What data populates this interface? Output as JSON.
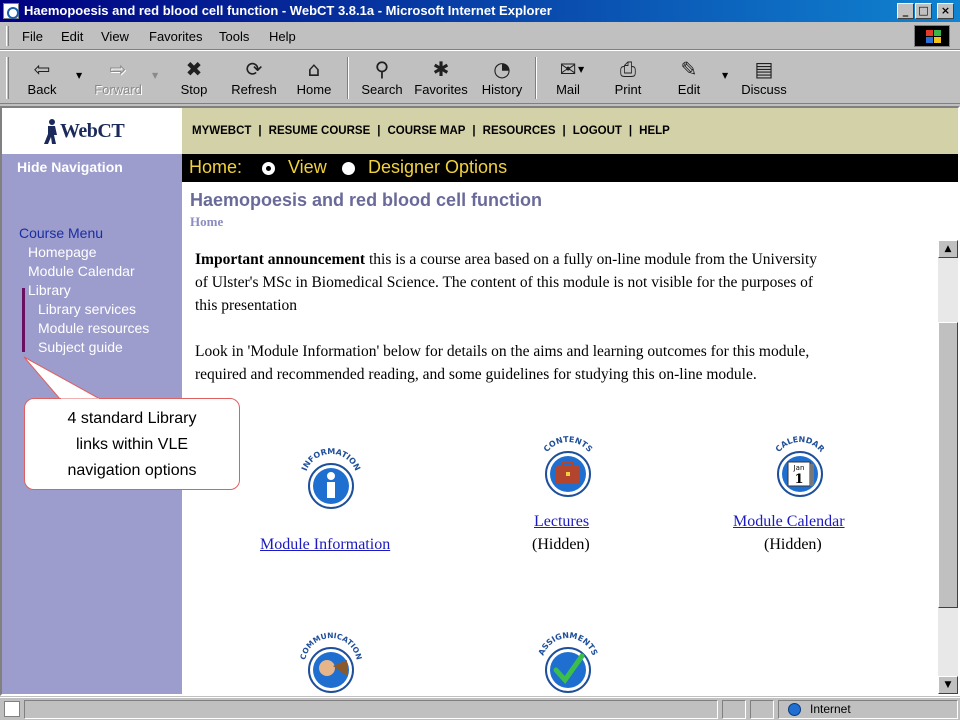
{
  "window": {
    "title": "Haemopoesis and red blood cell function - WebCT 3.8.1a - Microsoft Internet Explorer",
    "minimize": "_",
    "maximize": "□",
    "close": "×"
  },
  "menubar": {
    "items": [
      {
        "label": "File"
      },
      {
        "label": "Edit"
      },
      {
        "label": "View"
      },
      {
        "label": "Favorites"
      },
      {
        "label": "Tools"
      },
      {
        "label": "Help"
      }
    ]
  },
  "toolbar": {
    "buttons": [
      {
        "label": "Back",
        "icon": "back-arrow-icon",
        "glyph": "⇦"
      },
      {
        "label": "Forward",
        "icon": "forward-arrow-icon",
        "glyph": "⇨"
      },
      {
        "label": "Stop",
        "icon": "stop-icon",
        "glyph": "✖"
      },
      {
        "label": "Refresh",
        "icon": "refresh-icon",
        "glyph": "⟳"
      },
      {
        "label": "Home",
        "icon": "home-icon",
        "glyph": "⌂"
      },
      {
        "label": "Search",
        "icon": "search-icon",
        "glyph": "⚲"
      },
      {
        "label": "Favorites",
        "icon": "favorites-icon",
        "glyph": "✱"
      },
      {
        "label": "History",
        "icon": "history-icon",
        "glyph": "◔"
      },
      {
        "label": "Mail",
        "icon": "mail-icon",
        "glyph": "✉"
      },
      {
        "label": "Print",
        "icon": "print-icon",
        "glyph": "⎙"
      },
      {
        "label": "Edit",
        "icon": "edit-icon",
        "glyph": "✎"
      },
      {
        "label": "Discuss",
        "icon": "discuss-icon",
        "glyph": "▤"
      }
    ]
  },
  "webct": {
    "logo_text": "WebCT",
    "topnav": [
      "MYWEBCT",
      "RESUME COURSE",
      "COURSE MAP",
      "RESOURCES",
      "LOGOUT",
      "HELP"
    ],
    "topnav_sep": "|"
  },
  "leftnav": {
    "hide_label": "Hide Navigation",
    "course_menu": "Course Menu",
    "items": [
      {
        "label": "Homepage"
      },
      {
        "label": "Module Calendar"
      },
      {
        "label": "Library"
      },
      {
        "label": "Library services"
      },
      {
        "label": "Module resources"
      },
      {
        "label": "Subject guide"
      }
    ]
  },
  "homebar": {
    "label": "Home:",
    "view": "View",
    "designer": "Designer Options",
    "selected": "View"
  },
  "page": {
    "title": "Haemopoesis and red blood cell function",
    "breadcrumb": "Home"
  },
  "content": {
    "announcement_bold": "Important announcement",
    "announcement_line1": " this is a course area based on a fully on-line module from the University",
    "announcement_line2": "of Ulster's MSc in Biomedical Science. The content of this module is not visible for the purposes of",
    "announcement_line3": "this presentation",
    "info_line1": "Look in 'Module Information' below for details on the aims and learning outcomes for this module,",
    "info_line2": "required and recommended reading, and some guidelines for studying this on-line module."
  },
  "tools": [
    {
      "link": "Module Information",
      "status": "",
      "banner": "INFORMATION",
      "icon": "information-icon"
    },
    {
      "link": "Lectures",
      "status": "(Hidden)",
      "banner": "CONTENTS",
      "icon": "contents-briefcase-icon"
    },
    {
      "link": "Module Calendar",
      "status": "(Hidden)",
      "banner": "CALENDAR",
      "icon": "calendar-icon",
      "cal_month": "Jan",
      "cal_day": "1"
    },
    {
      "link": "",
      "status": "",
      "banner": "COMMUNICATION",
      "icon": "communication-icon"
    },
    {
      "link": "",
      "status": "",
      "banner": "ASSIGNMENTS",
      "icon": "assignments-check-icon"
    }
  ],
  "callout": {
    "line1": "4 standard Library",
    "line2": "links within VLE",
    "line3": "navigation options"
  },
  "statusbar": {
    "zone": "Internet"
  },
  "colors": {
    "nav_bg": "#9c9ccd",
    "header_bg": "#d3d1a8",
    "home_text": "#f2d23a",
    "link": "#1a1ac0",
    "icon_blue": "#1f6fd0"
  }
}
